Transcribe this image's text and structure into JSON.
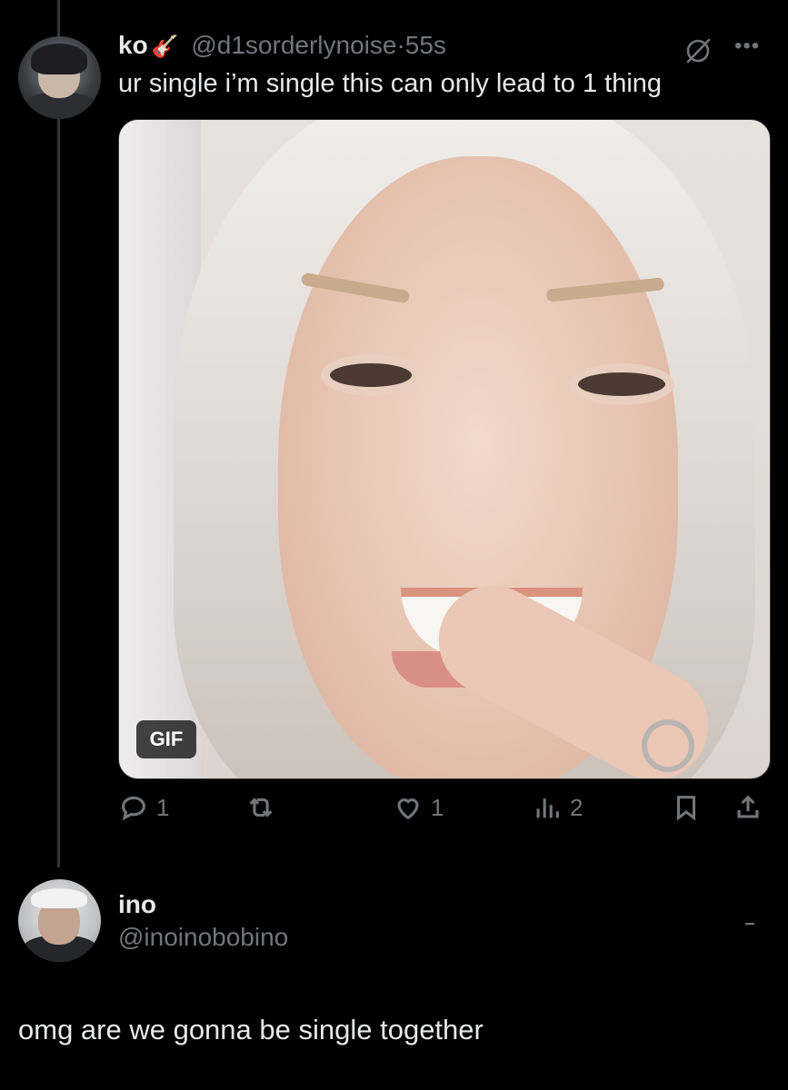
{
  "parent_tweet": {
    "author_name": "ko",
    "author_emoji": "guitar-emoji",
    "handle": "@d1sorderlynoise",
    "separator": "·",
    "time": "55s",
    "text": "ur single i’m single this can only lead to 1 thing",
    "media": {
      "badge": "GIF",
      "type": "gif"
    },
    "actions": {
      "replies": "1",
      "retweets": "",
      "likes": "1",
      "views": "2"
    },
    "icons": [
      "reply-icon",
      "retweet-icon",
      "like-icon",
      "views-icon",
      "bookmark-icon",
      "share-icon",
      "grok-icon",
      "more-icon"
    ]
  },
  "reply": {
    "author_name": "ino",
    "handle": "@inoinobobino",
    "text": "omg are we gonna be single together"
  },
  "colors": {
    "background": "#000000",
    "text_primary": "#e7e9ea",
    "text_secondary": "#71767b",
    "thread_line": "#333639"
  }
}
